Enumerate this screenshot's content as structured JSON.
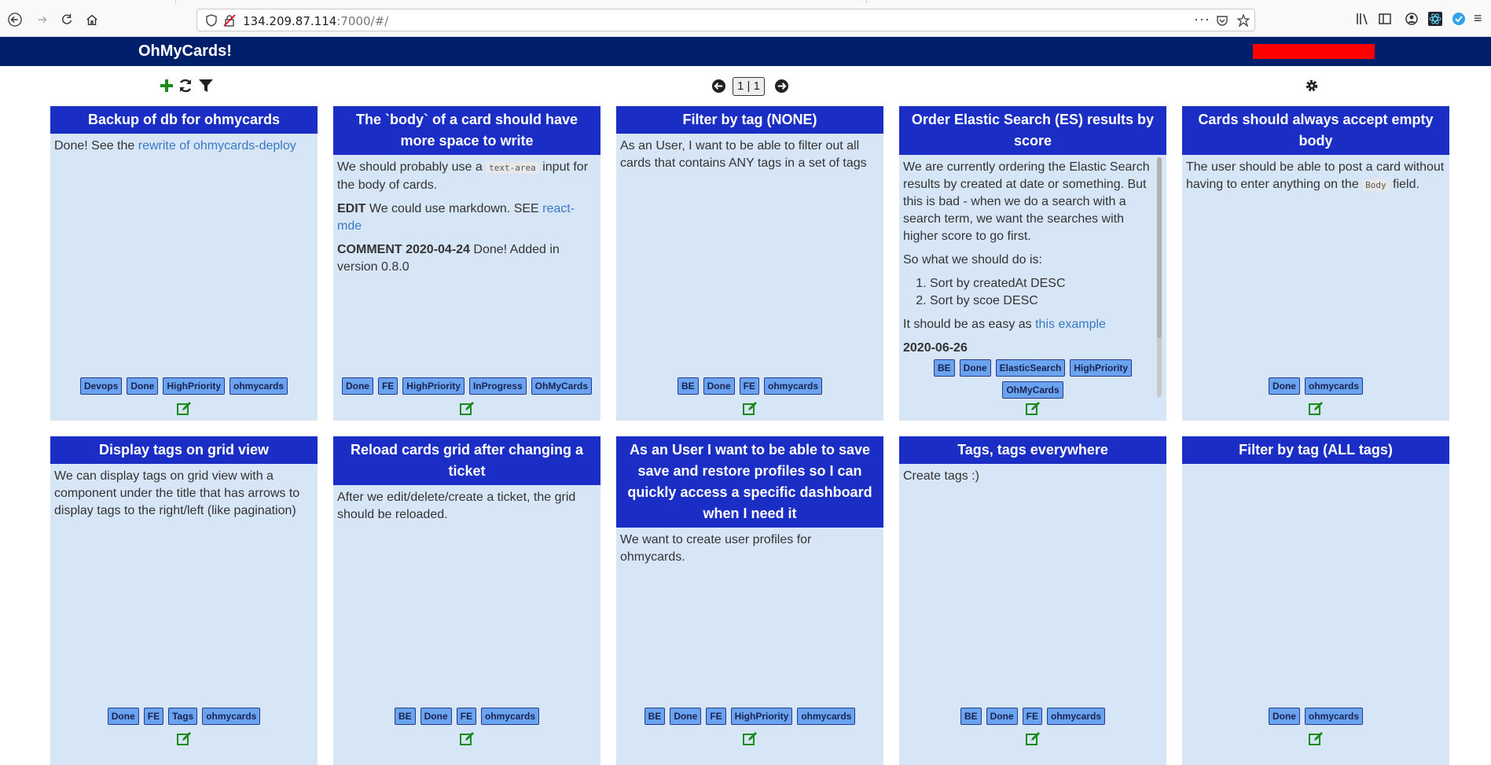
{
  "browser": {
    "url_host": "134.209.87.114",
    "url_rest": ":7000/#/"
  },
  "app": {
    "title": "OhMyCards!"
  },
  "toolbar": {
    "page_indicator": "1 | 1"
  },
  "cards": [
    {
      "title": "Backup of db for ohmycards",
      "body_prefix": "Done! See the ",
      "link": "rewrite of ohmycards-deploy",
      "tags": [
        "Devops",
        "Done",
        "HighPriority",
        "ohmycards"
      ]
    },
    {
      "title": "The `body` of a card should have more space to write",
      "p1_a": "We should probably use a ",
      "p1_code": "text-area",
      "p1_b": " input for the body of cards.",
      "p2_bold": "EDIT",
      "p2_text": " We could use markdown. SEE ",
      "p2_link": "react-mde",
      "p3_bold": "COMMENT 2020-04-24",
      "p3_text": " Done! Added in version 0.8.0",
      "tags": [
        "Done",
        "FE",
        "HighPriority",
        "InProgress",
        "OhMyCards"
      ]
    },
    {
      "title": "Filter by tag (NONE)",
      "body": "As an User, I want to be able to filter out all cards that contains ANY tags in a set of tags",
      "tags": [
        "BE",
        "Done",
        "FE",
        "ohmycards"
      ]
    },
    {
      "title": "Order Elastic Search (ES) results by score",
      "p1": "We are currently ordering the Elastic Search results by created at date or something. But this is bad - when we do a search with a search term, we want the searches with higher score to go first.",
      "p2": "So what we should do is:",
      "list": [
        "Sort by createdAt DESC",
        "Sort by scoe DESC"
      ],
      "p3_text": "It should be as easy as ",
      "p3_link": "this example",
      "p4_bold": "2020-06-26",
      "tags": [
        "BE",
        "Done",
        "ElasticSearch",
        "HighPriority",
        "OhMyCards"
      ]
    },
    {
      "title": "Cards should always accept empty body",
      "p1_a": "The user should be able to post a card without having to enter anything on the ",
      "p1_code": "Body",
      "p1_b": " field.",
      "tags": [
        "Done",
        "ohmycards"
      ]
    },
    {
      "title": "Display tags on grid view",
      "body": "We can display tags on grid view with a component under the title that has arrows to display tags to the right/left (like pagination)",
      "tags": [
        "Done",
        "FE",
        "Tags",
        "ohmycards"
      ]
    },
    {
      "title": "Reload cards grid after changing a ticket",
      "body": "After we edit/delete/create a ticket, the grid should be reloaded.",
      "tags": [
        "BE",
        "Done",
        "FE",
        "ohmycards"
      ]
    },
    {
      "title": "As an User I want to be able to save save and restore profiles so I can quickly access a specific dashboard when I need it",
      "body": "We want to create user profiles for ohmycards.",
      "tags": [
        "BE",
        "Done",
        "FE",
        "HighPriority",
        "ohmycards"
      ]
    },
    {
      "title": "Tags, tags everywhere",
      "body": "Create tags :)",
      "tags": [
        "BE",
        "Done",
        "FE",
        "ohmycards"
      ]
    },
    {
      "title": "Filter by tag (ALL tags)",
      "body": "",
      "tags": [
        "Done",
        "ohmycards"
      ]
    }
  ]
}
